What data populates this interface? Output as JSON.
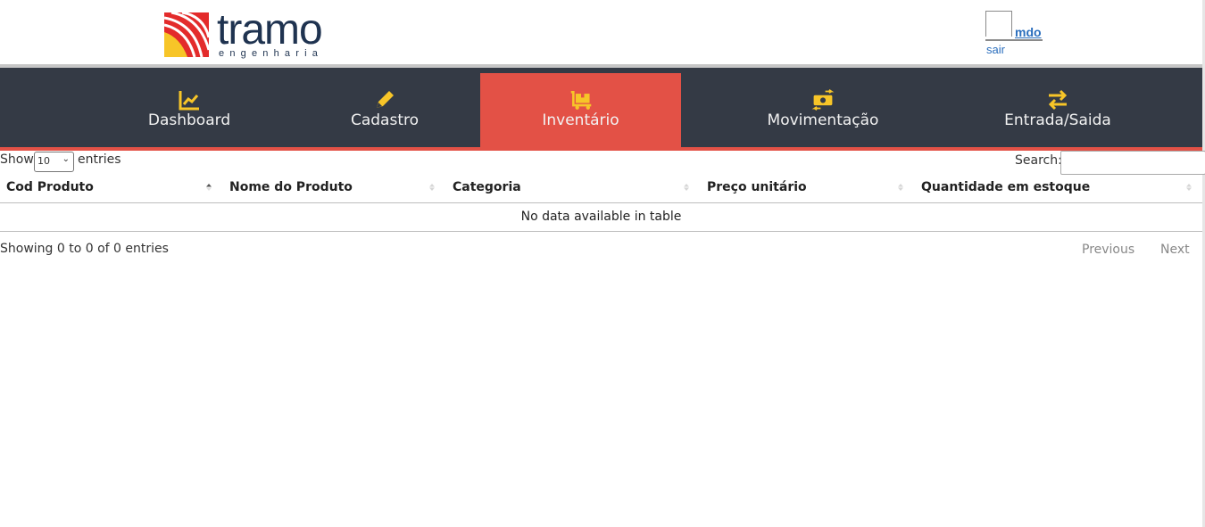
{
  "brand": {
    "name": "tramo",
    "subtitle": "engenharia",
    "colors": {
      "red": "#e32b2b",
      "yellow": "#f7c528",
      "navy": "#1f3350"
    }
  },
  "user": {
    "name": "mdo",
    "logout_label": "sair"
  },
  "nav": {
    "items": [
      {
        "label": "Dashboard",
        "icon": "chart-line-icon"
      },
      {
        "label": "Cadastro",
        "icon": "pencil-icon"
      },
      {
        "label": "Inventário",
        "icon": "dolly-boxes-icon",
        "active": true
      },
      {
        "label": "Movimentação",
        "icon": "money-exchange-icon"
      },
      {
        "label": "Entrada/Saida",
        "icon": "exchange-arrows-icon"
      }
    ],
    "colors": {
      "bg": "#343a45",
      "active": "#e35146",
      "icon": "#f7c528"
    }
  },
  "table_controls": {
    "show_label": "Show",
    "page_size": "10",
    "entries_label": "entries",
    "search_label": "Search:",
    "search_value": ""
  },
  "table": {
    "columns": [
      "Cod Produto",
      "Nome do Produto",
      "Categoria",
      "Preço unitário",
      "Quantidade em estoque"
    ],
    "empty_message": "No data available in table"
  },
  "footer": {
    "info": "Showing 0 to 0 of 0 entries",
    "previous_label": "Previous",
    "next_label": "Next"
  }
}
